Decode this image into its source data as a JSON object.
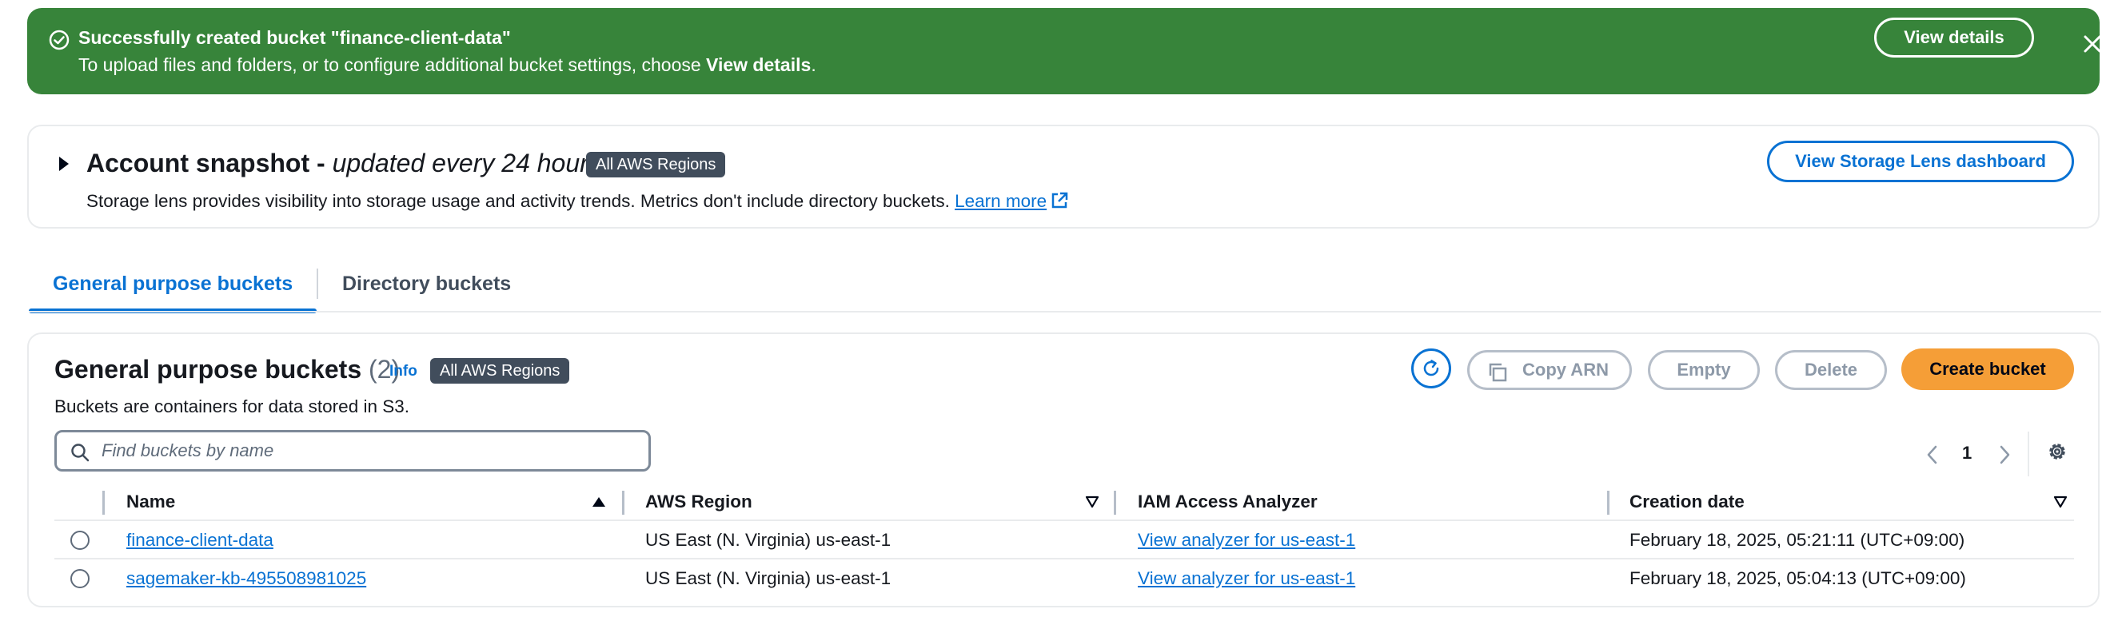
{
  "flash": {
    "title": "Successfully created bucket \"finance-client-data\"",
    "message_prefix": "To upload files and folders, or to configure additional bucket settings, choose ",
    "message_bold": "View details",
    "message_suffix": ".",
    "view_details_label": "View details",
    "background_color": "#37843a"
  },
  "snapshot": {
    "title_bold": "Account snapshot - ",
    "title_italic": "updated every 24 hours",
    "badge": "All AWS Regions",
    "description": "Storage lens provides visibility into storage usage and activity trends. Metrics don't include directory buckets. ",
    "learn_more": "Learn more",
    "button_label": "View Storage Lens dashboard"
  },
  "tabs": [
    {
      "label": "General purpose buckets",
      "active": true
    },
    {
      "label": "Directory buckets",
      "active": false
    }
  ],
  "panel": {
    "title": "General purpose buckets",
    "count": "(2)",
    "info": "Info",
    "badge": "All AWS Regions",
    "description": "Buckets are containers for data stored in S3.",
    "buttons": {
      "copy_arn": "Copy ARN",
      "empty": "Empty",
      "delete": "Delete",
      "create": "Create bucket"
    },
    "search_placeholder": "Find buckets by name",
    "page": "1"
  },
  "table": {
    "columns": [
      "Name",
      "AWS Region",
      "IAM Access Analyzer",
      "Creation date"
    ],
    "rows": [
      {
        "name": "finance-client-data",
        "region": "US East (N. Virginia) us-east-1",
        "analyzer": "View analyzer for us-east-1",
        "created": "February 18, 2025, 05:21:11 (UTC+09:00)"
      },
      {
        "name": "sagemaker-kb-495508981025",
        "region": "US East (N. Virginia) us-east-1",
        "analyzer": "View analyzer for us-east-1",
        "created": "February 18, 2025, 05:04:13 (UTC+09:00)"
      }
    ]
  },
  "colors": {
    "accent": "#0972d3",
    "primary_button": "#f59e37",
    "badge": "#414d5c"
  }
}
